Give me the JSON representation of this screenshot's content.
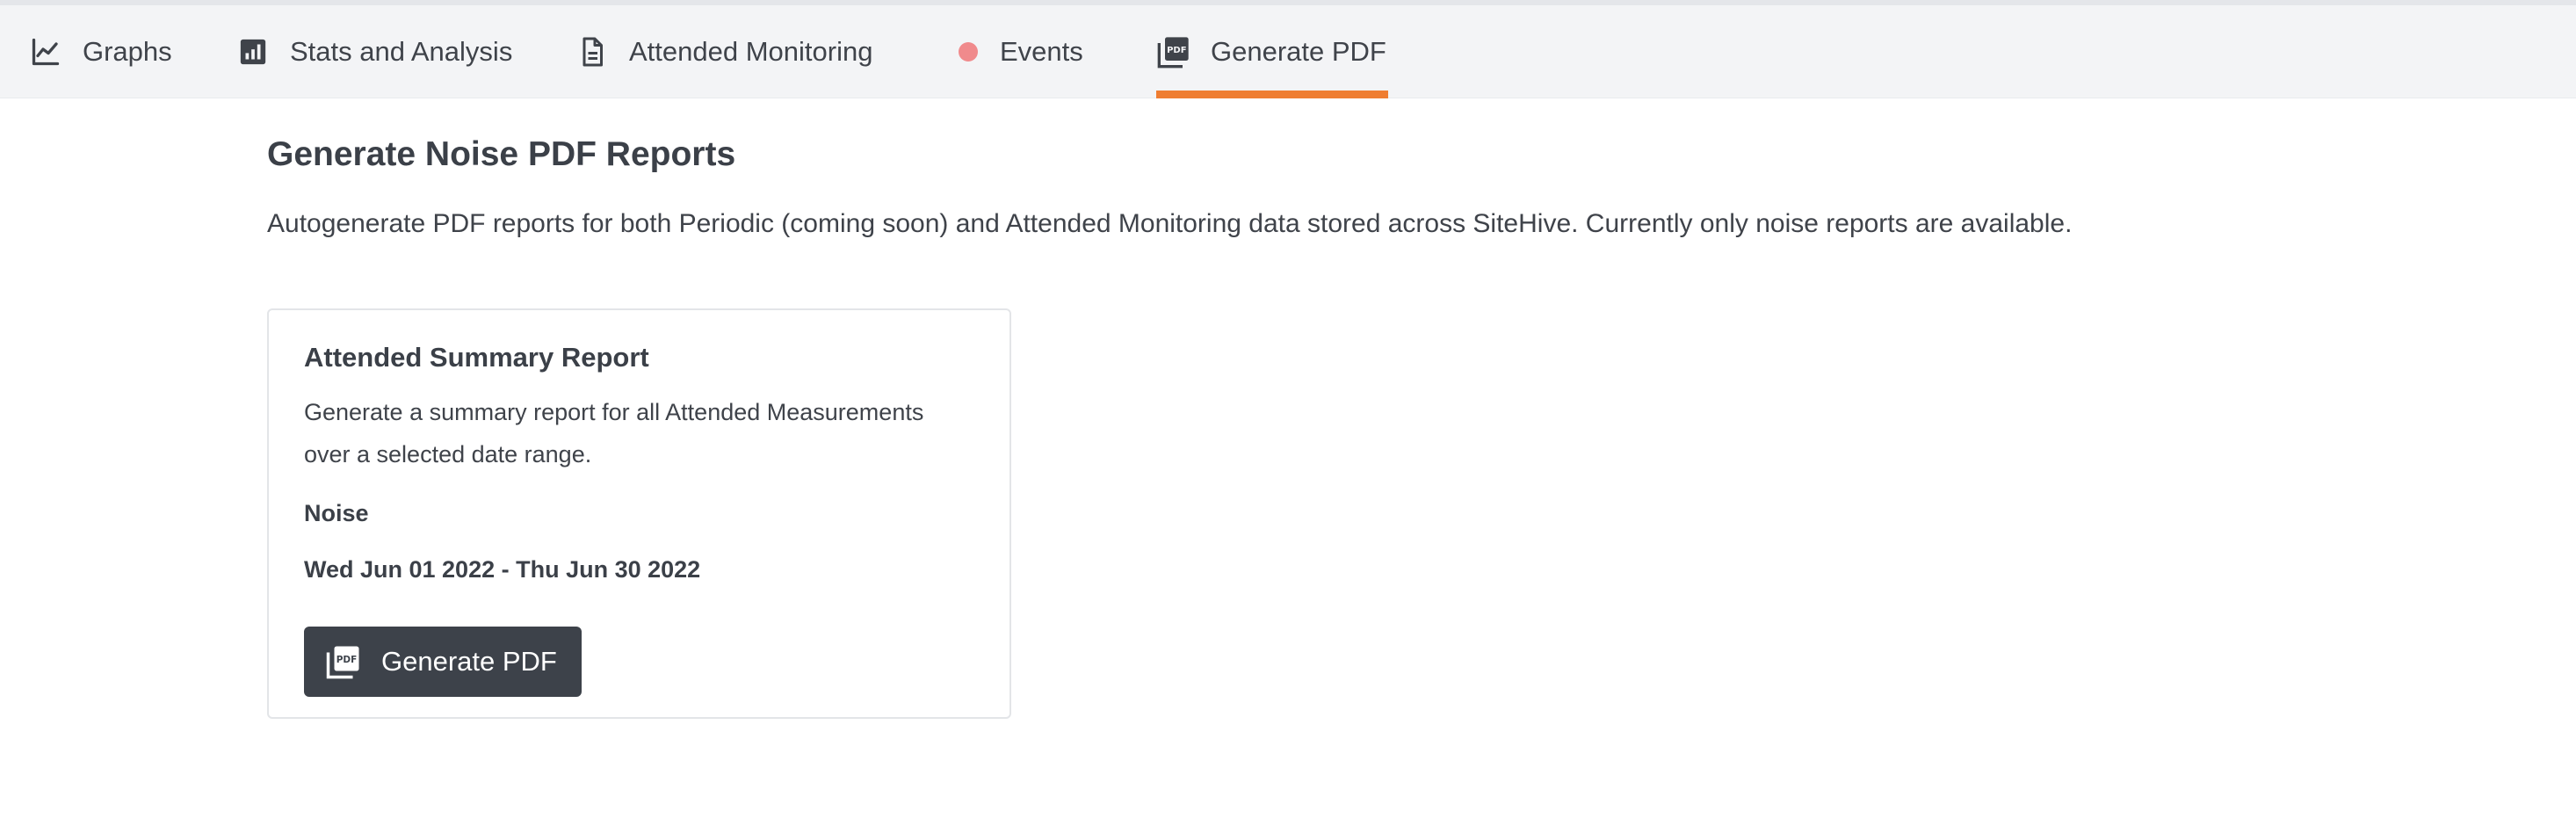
{
  "tabs": [
    {
      "label": "Graphs",
      "icon": "line-chart-icon",
      "active": false
    },
    {
      "label": "Stats and Analysis",
      "icon": "bar-chart-icon",
      "active": false
    },
    {
      "label": "Attended Monitoring",
      "icon": "document-icon",
      "active": false
    },
    {
      "label": "Events",
      "icon": "status-dot-icon",
      "active": false
    },
    {
      "label": "Generate PDF",
      "icon": "pdf-icon",
      "active": true
    }
  ],
  "page": {
    "title": "Generate Noise PDF Reports",
    "description": "Autogenerate PDF reports for both Periodic (coming soon) and Attended Monitoring data stored across SiteHive. Currently only noise reports are available."
  },
  "card": {
    "title": "Attended Summary Report",
    "description": "Generate a summary report for all Attended Measurements over a selected date range.",
    "type": "Noise",
    "date_range": "Wed Jun 01 2022 - Thu Jun 30 2022",
    "button_label": "Generate PDF"
  },
  "colors": {
    "accent": "#ef7d31",
    "events_dot": "#f08a8c",
    "button_bg": "#3d424a"
  }
}
